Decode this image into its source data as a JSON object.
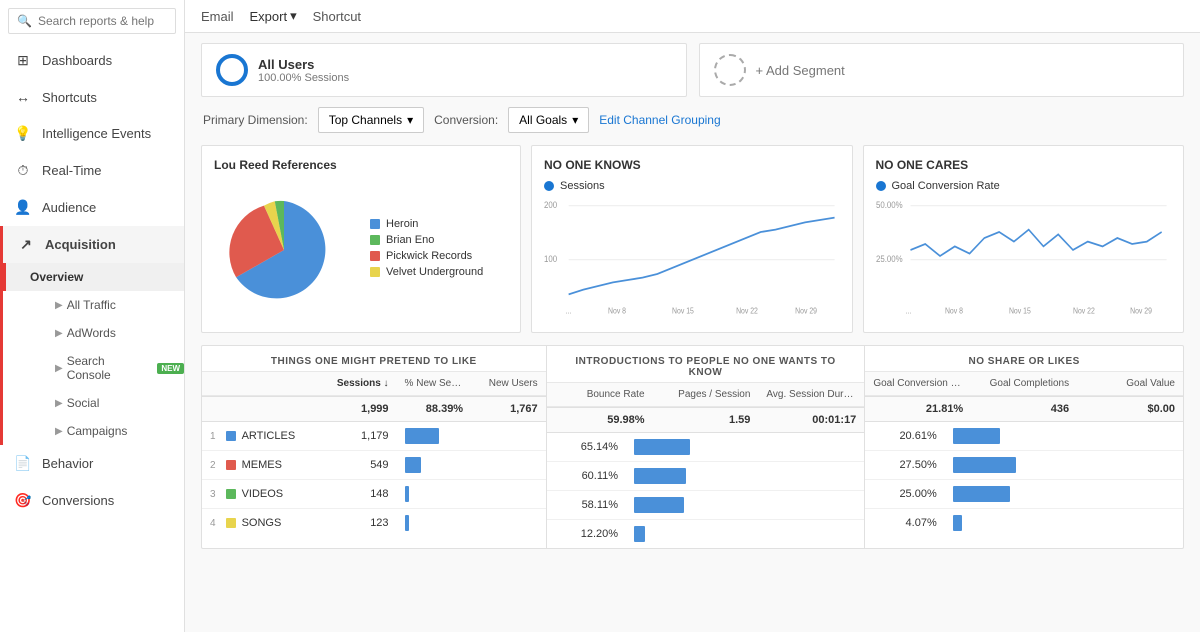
{
  "sidebar": {
    "search_placeholder": "Search reports & help",
    "items": [
      {
        "id": "dashboards",
        "label": "Dashboards",
        "icon": "⊞"
      },
      {
        "id": "shortcuts",
        "label": "Shortcuts",
        "icon": "←"
      },
      {
        "id": "intelligence",
        "label": "Intelligence Events",
        "icon": "💡"
      },
      {
        "id": "realtime",
        "label": "Real-Time",
        "icon": "⏱"
      },
      {
        "id": "audience",
        "label": "Audience",
        "icon": "👤"
      },
      {
        "id": "acquisition",
        "label": "Acquisition",
        "icon": "↗"
      },
      {
        "id": "behavior",
        "label": "Behavior",
        "icon": "📄"
      },
      {
        "id": "conversions",
        "label": "Conversions",
        "icon": "🎯"
      }
    ],
    "acquisition_sub": [
      {
        "id": "all-traffic",
        "label": "All Traffic"
      },
      {
        "id": "adwords",
        "label": "AdWords"
      },
      {
        "id": "search-console",
        "label": "Search Console",
        "badge": "NEW"
      },
      {
        "id": "social",
        "label": "Social"
      },
      {
        "id": "campaigns",
        "label": "Campaigns"
      }
    ],
    "overview_label": "Overview"
  },
  "topbar": {
    "email": "Email",
    "export": "Export",
    "shortcut": "Shortcut"
  },
  "segments": {
    "all_users_label": "All Users",
    "all_users_sub": "100.00% Sessions",
    "add_segment_label": "+ Add Segment"
  },
  "dimensions": {
    "primary_label": "Primary Dimension:",
    "conversion_label": "Conversion:",
    "top_channels": "Top Channels",
    "all_goals": "All Goals",
    "edit_channel": "Edit Channel Grouping"
  },
  "chart1": {
    "title": "Lou Reed References",
    "segments": [
      {
        "label": "Heroin",
        "color": "#4a90d9",
        "value": 59,
        "pct": "59%"
      },
      {
        "label": "Brian Eno",
        "color": "#5cb85c",
        "value": 7.4,
        "pct": "7.4%"
      },
      {
        "label": "Pickwick Records",
        "color": "#e05a4e",
        "value": 27.5,
        "pct": "27.5%"
      },
      {
        "label": "Velvet Underground",
        "color": "#e8d44d",
        "value": 6.1,
        "pct": ""
      }
    ]
  },
  "chart2": {
    "title": "NO ONE KNOWS",
    "legend": "Sessions",
    "y_max": "200",
    "y_mid": "100",
    "x_labels": [
      "Nov 8",
      "Nov 15",
      "Nov 22",
      "Nov 29"
    ],
    "x_start": "..."
  },
  "chart3": {
    "title": "NO ONE CARES",
    "legend": "Goal Conversion Rate",
    "y_top": "50.00%",
    "y_mid": "25.00%",
    "x_labels": [
      "Nov 8",
      "Nov 15",
      "Nov 22",
      "Nov 29"
    ],
    "x_start": "..."
  },
  "table": {
    "section1_title": "THINGS ONE MIGHT PRETEND TO LIKE",
    "section2_title": "INTRODUCTIONS TO PEOPLE NO ONE WANTS TO KNOW",
    "section3_title": "NO SHARE OR LIKES",
    "col_headers": {
      "sessions": "Sessions",
      "new_sessions_pct": "% New Sessions",
      "new_users": "New Users",
      "bounce_rate": "Bounce Rate",
      "pages_session": "Pages / Session",
      "avg_duration": "Avg. Session Duration",
      "goal_conv_rate": "Goal Conversion Rate",
      "goal_completions": "Goal Completions",
      "goal_value": "Goal Value"
    },
    "totals": {
      "sessions": "1,999",
      "new_sessions_pct": "88.39%",
      "new_users": "1,767",
      "bounce_rate": "59.98%",
      "pages_session": "1.59",
      "avg_duration": "00:01:17",
      "goal_conv_rate": "21.81%",
      "goal_completions": "436",
      "goal_value": "$0.00"
    },
    "rows": [
      {
        "num": 1,
        "label": "ARTICLES",
        "color": "#4a90d9",
        "sessions": "1,179",
        "new_pct": 59,
        "new_users": "",
        "bounce": "65.14%",
        "bounce_pct": 88,
        "pages": "",
        "duration": "",
        "goal_rate": "20.61%",
        "goal_pct": 75,
        "completions": "",
        "value": ""
      },
      {
        "num": 2,
        "label": "MEMES",
        "color": "#e05a4e",
        "sessions": "549",
        "new_pct": 28,
        "new_users": "",
        "bounce": "60.11%",
        "bounce_pct": 82,
        "pages": "",
        "duration": "",
        "goal_rate": "27.50%",
        "goal_pct": 100,
        "completions": "",
        "value": ""
      },
      {
        "num": 3,
        "label": "VIDEOS",
        "color": "#5cb85c",
        "sessions": "148",
        "new_pct": 8,
        "new_users": "",
        "bounce": "58.11%",
        "bounce_pct": 79,
        "pages": "",
        "duration": "",
        "goal_rate": "25.00%",
        "goal_pct": 91,
        "completions": "",
        "value": ""
      },
      {
        "num": 4,
        "label": "SONGS",
        "color": "#e8d44d",
        "sessions": "123",
        "new_pct": 7,
        "new_users": "",
        "bounce": "12.20%",
        "bounce_pct": 17,
        "pages": "",
        "duration": "",
        "goal_rate": "4.07%",
        "goal_pct": 15,
        "completions": "",
        "value": ""
      }
    ]
  }
}
